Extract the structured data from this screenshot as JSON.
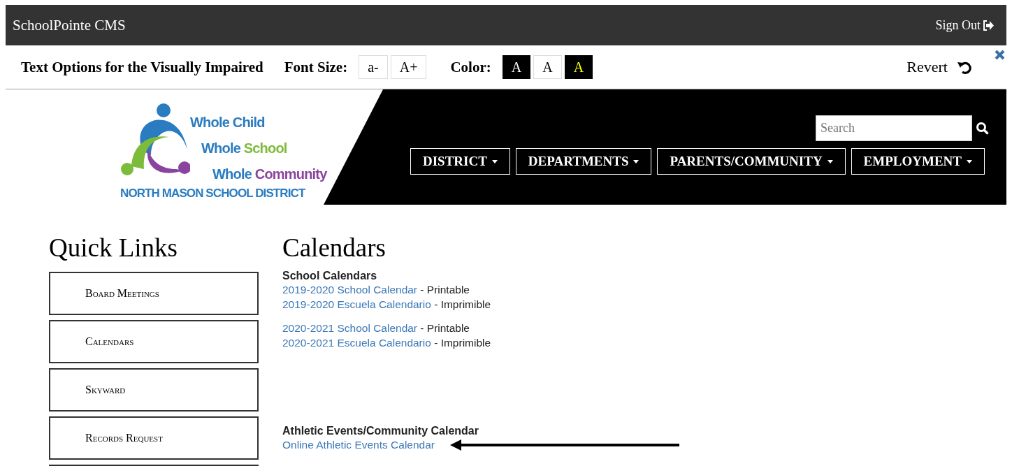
{
  "top_bar": {
    "title": "SchoolPointe CMS",
    "sign_out": "Sign Out"
  },
  "accessibility_bar": {
    "title": "Text Options for the Visually Impaired",
    "font_size_label": "Font Size:",
    "font_size_buttons": [
      "a-",
      "A+"
    ],
    "color_label": "Color:",
    "color_options": [
      {
        "label": "A",
        "kind": "dark"
      },
      {
        "label": "A",
        "kind": "light"
      },
      {
        "label": "A",
        "kind": "yellow"
      }
    ],
    "revert": "Revert"
  },
  "logo": {
    "lines": [
      {
        "words": [
          {
            "text": "Whole",
            "color": "#2a7cc0"
          },
          {
            "text": "Child",
            "color": "#2a7cc0"
          }
        ]
      },
      {
        "words": [
          {
            "text": "Whole",
            "color": "#2a7cc0"
          },
          {
            "text": "School",
            "color": "#7dbb3a"
          }
        ]
      },
      {
        "words": [
          {
            "text": "Whole",
            "color": "#2a7cc0"
          },
          {
            "text": "Community",
            "color": "#8a44a0"
          }
        ]
      }
    ],
    "name": "NORTH MASON SCHOOL DISTRICT"
  },
  "search": {
    "placeholder": "Search"
  },
  "nav": [
    "DISTRICT",
    "DEPARTMENTS",
    "PARENTS/COMMUNITY",
    "EMPLOYMENT"
  ],
  "quick_links": {
    "title": "Quick Links",
    "items": [
      "Board Meetings",
      "Calendars",
      "Skyward",
      "Records Request"
    ]
  },
  "content": {
    "title": "Calendars",
    "sections": [
      {
        "heading": "School Calendars",
        "groups": [
          [
            {
              "link": "2019-2020 School Calendar",
              "note": " - Printable"
            },
            {
              "link": "2019-2020 Escuela Calendario",
              "note": " - Imprimible"
            }
          ],
          [
            {
              "link": "2020-2021 School Calendar",
              "note": " - Printable"
            },
            {
              "link": "2020-2021 Escuela Calendario",
              "note": " - Imprimible"
            }
          ]
        ]
      },
      {
        "heading": "Athletic Events/Community Calendar",
        "groups": [
          [
            {
              "link": "Online Athletic Events Calendar",
              "arrow": true
            }
          ]
        ]
      }
    ]
  }
}
